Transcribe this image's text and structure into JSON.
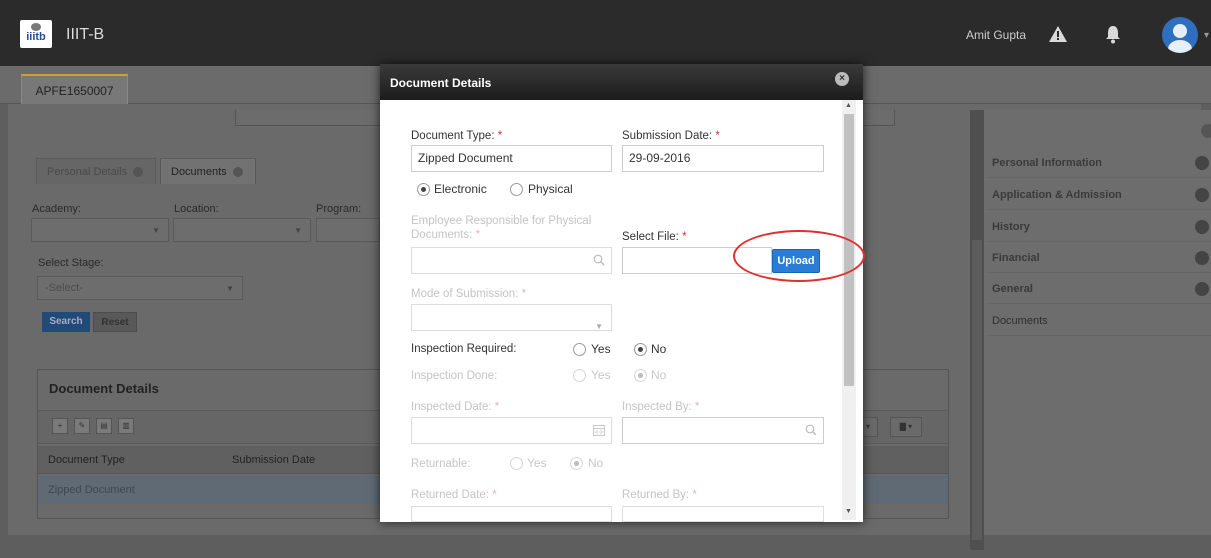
{
  "header": {
    "app_title": "IIIT-B",
    "logo_text": "iiitb",
    "user_name": "Amit Gupta"
  },
  "record_tab": "APFE1650007",
  "inner_tabs": [
    "Personal Details",
    "Documents"
  ],
  "filters": {
    "academy_label": "Academy:",
    "location_label": "Location:",
    "program_label": "Program:",
    "stage_label": "Select Stage:",
    "stage_value": "-Select-",
    "search_label": "Search",
    "reset_label": "Reset"
  },
  "grid": {
    "title": "Document Details",
    "columns": [
      "Document Type",
      "Submission Date"
    ],
    "rows": [
      [
        "Zipped Document",
        ""
      ]
    ]
  },
  "side_menu": [
    "Personal Information",
    "Application & Admission",
    "History",
    "Financial",
    "General",
    "Documents"
  ],
  "modal": {
    "title": "Document Details",
    "doc_type_label": "Document Type:",
    "doc_type_value": "Zipped Document",
    "submission_date_label": "Submission Date:",
    "submission_date_value": "29-09-2016",
    "electronic_label": "Electronic",
    "physical_label": "Physical",
    "employee_label_1": "Employee Responsible for Physical",
    "employee_label_2": "Documents:",
    "select_file_label": "Select File:",
    "upload_label": "Upload",
    "mode_label": "Mode of Submission:",
    "inspection_required_label": "Inspection Required:",
    "inspection_done_label": "Inspection Done:",
    "yes_label": "Yes",
    "no_label": "No",
    "inspected_date_label": "Inspected Date:",
    "inspected_by_label": "Inspected By:",
    "returnable_label": "Returnable:",
    "returned_date_label": "Returned Date:",
    "returned_by_label": "Returned By:",
    "required_mark": "*"
  },
  "colors": {
    "upload_button": "#2b7cd3",
    "required": "#dd3333",
    "annotation_ellipse": "#e03030"
  }
}
